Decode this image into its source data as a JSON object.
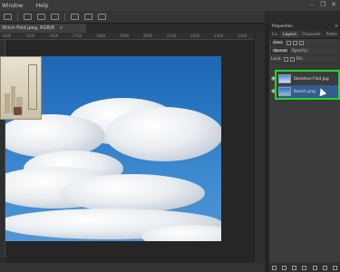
{
  "menubar": {
    "items": [
      "Window",
      "Help"
    ],
    "controls": [
      "minimize-icon",
      "restore-icon",
      "close-icon"
    ]
  },
  "document": {
    "tab_title": "Stitch-Fold.jpeg, RGB/8",
    "tab_close": "×"
  },
  "ruler": {
    "ticks": [
      "1400",
      "1500",
      "1600",
      "1700",
      "1800",
      "1900",
      "2000",
      "2100",
      "2200",
      "2300",
      "2400"
    ]
  },
  "panel": {
    "header": "Properties",
    "menu_icon": "≡",
    "tabs": [
      "Co",
      "Layers",
      "Channels",
      "Paths"
    ],
    "active_tab": "Layers",
    "kind_label": "Kind",
    "blend_mode": "Normal",
    "opacity_label": "Opacity:",
    "lock_label": "Lock:",
    "fill_label": "Fill:"
  },
  "layers": [
    {
      "name": "Skeleton-Fold.jpg",
      "visible": true,
      "selected": false
    },
    {
      "name": "Beach.png",
      "visible": true,
      "selected": true
    }
  ],
  "colors": {
    "highlight": "#22d62a",
    "selection": "#345d8c",
    "sky": "#2a78c4"
  }
}
